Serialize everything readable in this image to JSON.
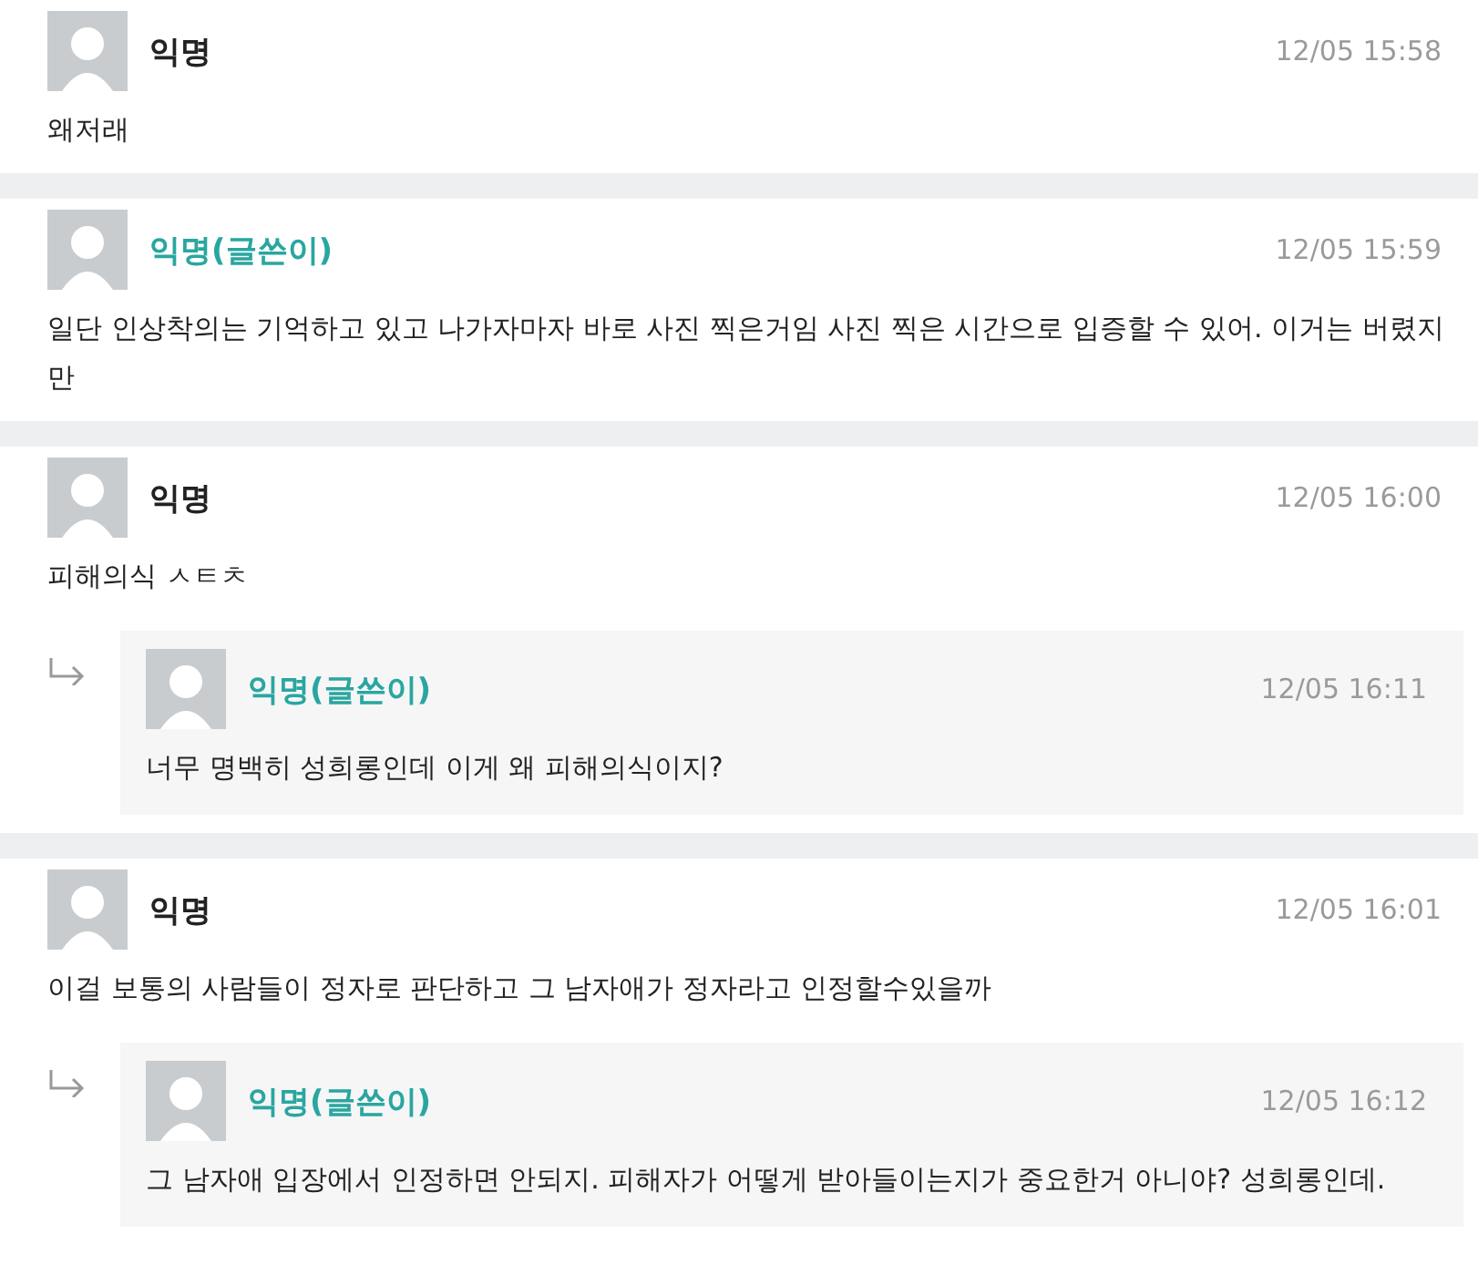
{
  "comments": [
    {
      "kind": "member",
      "author": "익명",
      "time": "12/05 15:58",
      "text": "왜저래"
    },
    {
      "kind": "writer",
      "author": "익명(글쓴이)",
      "time": "12/05 15:59",
      "text": "일단 인상착의는 기억하고 있고 나가자마자 바로 사진 찍은거임 사진 찍은 시간으로 입증할 수 있어. 이거는 버렸지만"
    },
    {
      "kind": "member",
      "author": "익명",
      "time": "12/05 16:00",
      "text": "피해의식 ㅅㅌㅊ",
      "replies": [
        {
          "kind": "writer",
          "author": "익명(글쓴이)",
          "time": "12/05 16:11",
          "text": "너무 명백히 성희롱인데 이게 왜 피해의식이지?"
        }
      ]
    },
    {
      "kind": "member",
      "author": "익명",
      "time": "12/05 16:01",
      "text": "이걸 보통의 사람들이 정자로 판단하고 그 남자애가 정자라고 인정할수있을까",
      "replies": [
        {
          "kind": "writer",
          "author": "익명(글쓴이)",
          "time": "12/05 16:12",
          "text": "그 남자애 입장에서 인정하면 안되지. 피해자가 어떻게 받아들이는지가 중요한거 아니야? 성희롱인데."
        }
      ]
    }
  ]
}
